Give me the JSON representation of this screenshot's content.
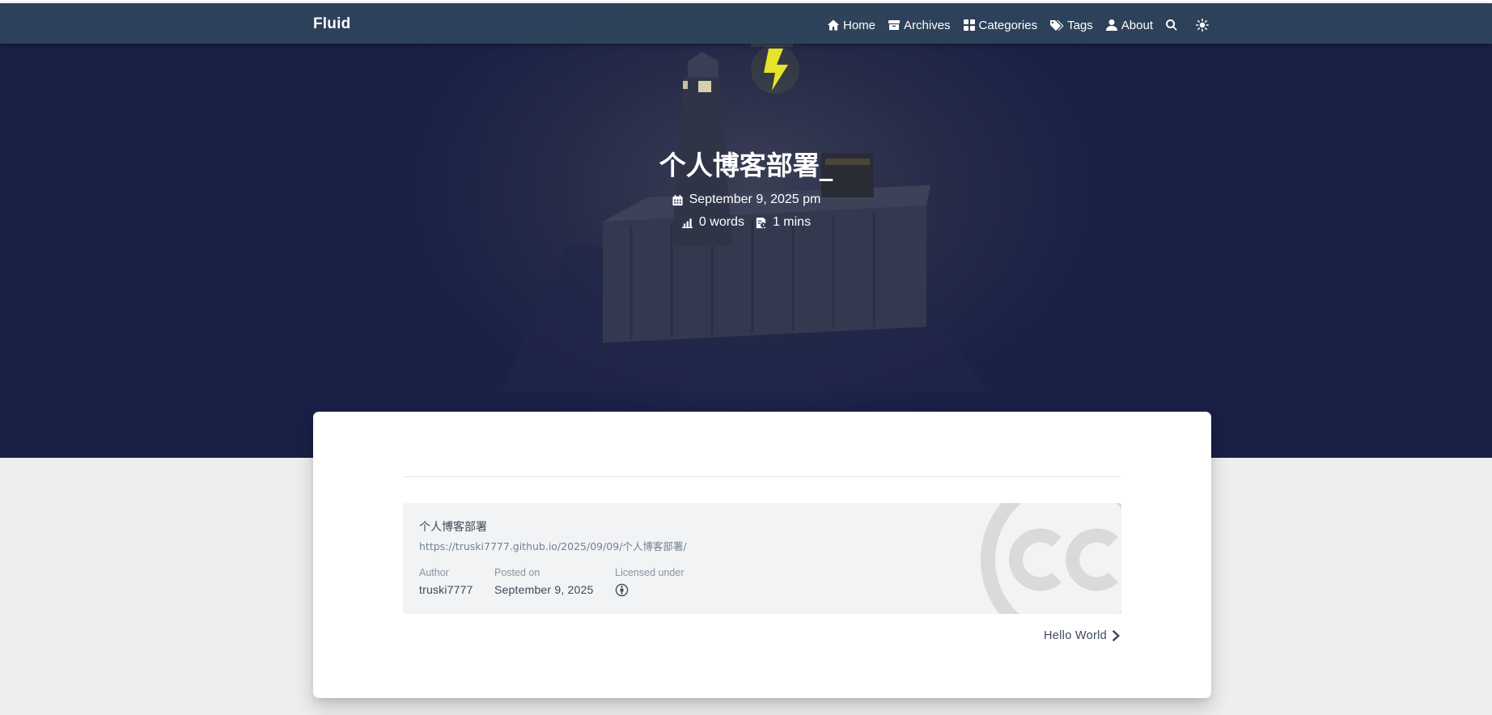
{
  "navbar": {
    "brand": "Fluid",
    "items": [
      {
        "label": "Home",
        "icon": "home-icon"
      },
      {
        "label": "Archives",
        "icon": "archive-icon"
      },
      {
        "label": "Categories",
        "icon": "categories-icon"
      },
      {
        "label": "Tags",
        "icon": "tags-icon"
      },
      {
        "label": "About",
        "icon": "user-icon"
      }
    ],
    "search_icon": "search-icon",
    "theme_icon": "sun-icon"
  },
  "post": {
    "title": "个人博客部署_",
    "date": "September 9, 2025 pm",
    "words": "0 words",
    "read_time": "1 mins"
  },
  "license": {
    "title": "个人博客部署",
    "url": "https://truski7777.github.io/2025/09/09/个人博客部署/",
    "author_label": "Author",
    "author": "truski7777",
    "posted_label": "Posted on",
    "posted": "September 9, 2025",
    "licensed_label": "Licensed under",
    "license_icon": "cc-by-icon"
  },
  "nav_next": {
    "label": "Hello World"
  },
  "colors": {
    "navbar": "#30445c",
    "hero": "#1b2146",
    "page_bg": "#eeeeee",
    "card": "#ffffff",
    "text": "#3c4858",
    "lightning": "#e4e42a"
  }
}
